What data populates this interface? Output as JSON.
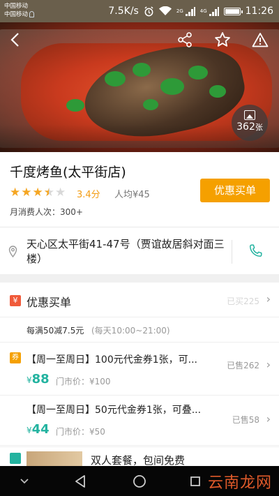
{
  "status_bar": {
    "carrier_1": "中国移动",
    "carrier_2": "中国移动",
    "speed": "7.5K/s",
    "net_2g": "2G",
    "net_4g": "4G",
    "time": "11:26"
  },
  "hero": {
    "photo_count": "362",
    "photo_unit": "张"
  },
  "shop": {
    "name": "千度烤鱼(太平街店)",
    "rating": 3.4,
    "rating_max": 5,
    "score_label": "3.4分",
    "avg_price": "人均¥45",
    "monthly_consumers": "月消费人次：300+",
    "buy_button": "优惠买单"
  },
  "address": {
    "text": "天心区太平街41-47号（贾谊故居斜对面三楼）"
  },
  "discount": {
    "icon_char": "¥",
    "title": "优惠买单",
    "sold": "已买225",
    "rule": "每满50减7.5元",
    "hours": "(每天10:00~21:00)"
  },
  "vouchers": [
    {
      "icon_char": "券",
      "title": "【周一至周日】100元代金券1张，可...",
      "currency": "¥",
      "price": "88",
      "orig_price": "门市价：¥100",
      "sold": "已售262"
    },
    {
      "title": "【周一至周日】50元代金券1张，可叠...",
      "currency": "¥",
      "price": "44",
      "orig_price": "门市价：¥50",
      "sold": "已售58"
    }
  ],
  "partial_item": {
    "title": "双人套餐，包间免费"
  },
  "watermark": "云南龙网",
  "colors": {
    "accent_orange": "#f5a000",
    "price_teal": "#23b3a0",
    "star": "#f5a623"
  }
}
